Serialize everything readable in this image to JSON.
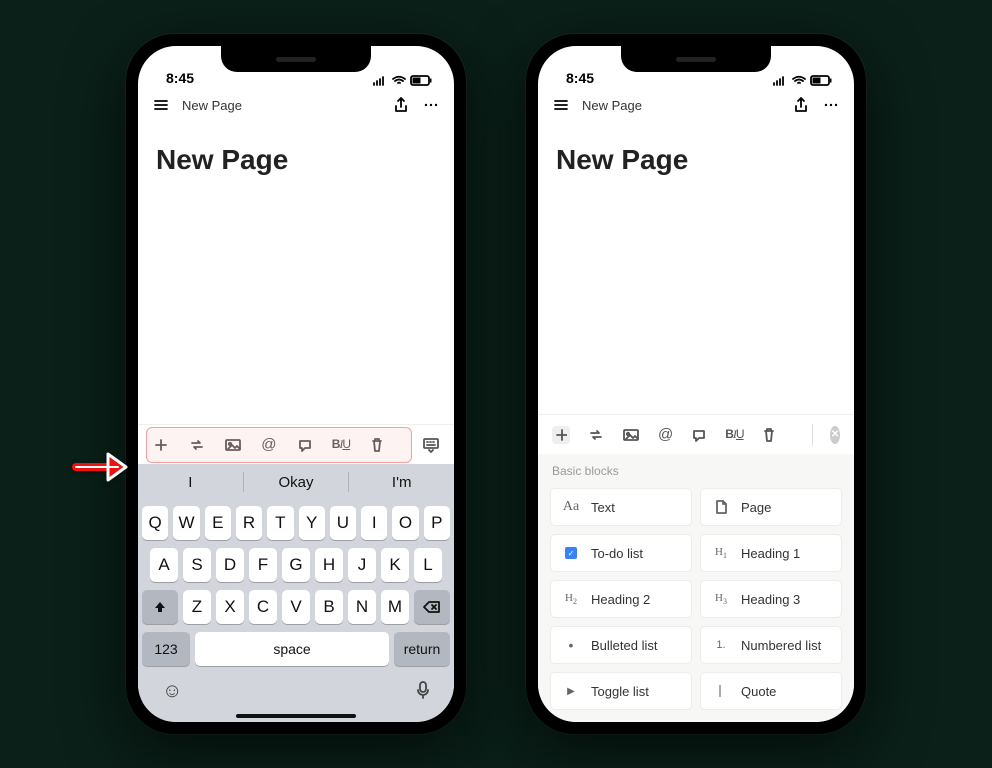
{
  "status": {
    "time": "8:45"
  },
  "header": {
    "title": "New Page"
  },
  "page": {
    "title": "New Page"
  },
  "toolbar": {
    "biu_b": "B",
    "biu_i": "I",
    "biu_u": "U"
  },
  "suggestions": {
    "a": "I",
    "b": "Okay",
    "c": "I'm"
  },
  "keyboard": {
    "row1": [
      "Q",
      "W",
      "E",
      "R",
      "T",
      "Y",
      "U",
      "I",
      "O",
      "P"
    ],
    "row2": [
      "A",
      "S",
      "D",
      "F",
      "G",
      "H",
      "J",
      "K",
      "L"
    ],
    "row3": [
      "Z",
      "X",
      "C",
      "V",
      "B",
      "N",
      "M"
    ],
    "num": "123",
    "space": "space",
    "return": "return"
  },
  "picker": {
    "section": "Basic blocks",
    "blocks": [
      {
        "icon": "Aa",
        "label": "Text"
      },
      {
        "icon": "page",
        "label": "Page"
      },
      {
        "icon": "todo",
        "label": "To-do list"
      },
      {
        "icon": "H1",
        "label": "Heading 1"
      },
      {
        "icon": "H2",
        "label": "Heading 2"
      },
      {
        "icon": "H3",
        "label": "Heading 3"
      },
      {
        "icon": "bullet",
        "label": "Bulleted list"
      },
      {
        "icon": "1.",
        "label": "Numbered list"
      },
      {
        "icon": "toggle",
        "label": "Toggle list"
      },
      {
        "icon": "quote",
        "label": "Quote"
      }
    ]
  }
}
